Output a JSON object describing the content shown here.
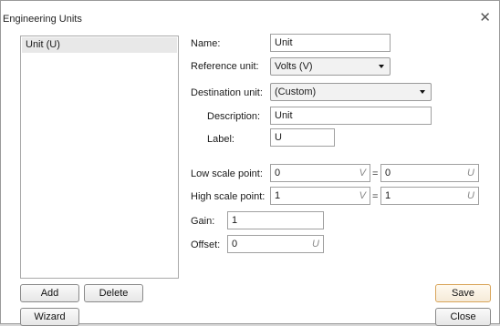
{
  "window": {
    "title": "Engineering Units"
  },
  "list": {
    "items": [
      "Unit (U)"
    ]
  },
  "buttons": {
    "add": "Add",
    "delete": "Delete",
    "wizard": "Wizard",
    "save": "Save",
    "close": "Close"
  },
  "form": {
    "name_label": "Name:",
    "name_value": "Unit",
    "reference_label": "Reference unit:",
    "reference_value": "Volts (V)",
    "destination_label": "Destination unit:",
    "destination_value": "(Custom)",
    "description_label": "Description:",
    "description_value": "Unit",
    "label_label": "Label:",
    "label_value": "U",
    "low_label": "Low scale point:",
    "low_ref_value": "0",
    "low_ref_unit": "V",
    "low_dest_value": "0",
    "low_dest_unit": "U",
    "high_label": "High scale point:",
    "high_ref_value": "1",
    "high_ref_unit": "V",
    "high_dest_value": "1",
    "high_dest_unit": "U",
    "equals": "=",
    "gain_label": "Gain:",
    "gain_value": "1",
    "offset_label": "Offset:",
    "offset_value": "0",
    "offset_unit": "U"
  },
  "icons": {
    "close": "close-icon",
    "dropdown": "chevron-down-icon"
  }
}
